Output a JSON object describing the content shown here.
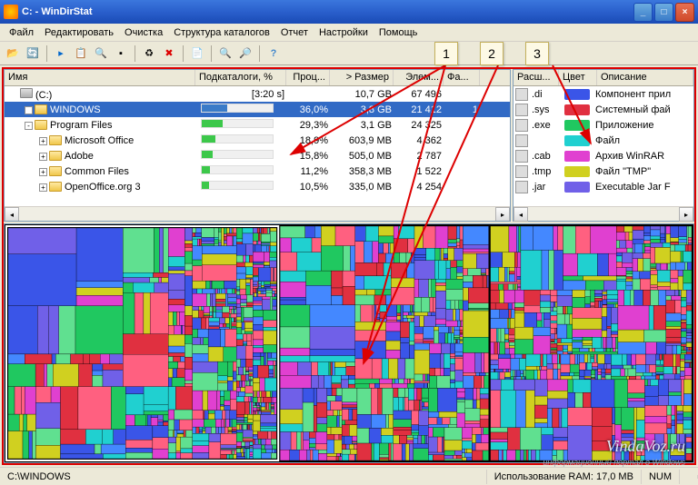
{
  "window": {
    "title": "C: - WinDirStat"
  },
  "menu": {
    "file": "Файл",
    "edit": "Редактировать",
    "cleanup": "Очистка",
    "structure": "Структура каталогов",
    "report": "Отчет",
    "settings": "Настройки",
    "help": "Помощь"
  },
  "callouts": [
    "1",
    "2",
    "3"
  ],
  "tree": {
    "headers": {
      "name": "Имя",
      "subdirs": "Подкаталоги, %",
      "percent": "Проц...",
      "size": "> Размер",
      "items": "Элем...",
      "files": "Фа..."
    },
    "rows": [
      {
        "indent": 0,
        "expander": "",
        "icon": "drive",
        "name": "(C:)",
        "pct": "",
        "size": "10,7 GB",
        "items": "67 496",
        "time_hint": "[3:20 s]",
        "bar": 100,
        "barColor": "#3a7bc8",
        "selected": false
      },
      {
        "indent": 1,
        "expander": "+",
        "icon": "folder",
        "name": "WINDOWS",
        "pct": "36,0%",
        "size": "3,8 GB",
        "items": "21 412",
        "files": "1",
        "bar": 36,
        "barColor": "#3a7bc8",
        "selected": true
      },
      {
        "indent": 1,
        "expander": "-",
        "icon": "folder",
        "name": "Program Files",
        "pct": "29,3%",
        "size": "3,1 GB",
        "items": "24 325",
        "bar": 29,
        "barColor": "#3cc84a",
        "selected": false
      },
      {
        "indent": 2,
        "expander": "+",
        "icon": "folder",
        "name": "Microsoft Office",
        "pct": "18,9%",
        "size": "603,9 MB",
        "items": "4 362",
        "bar": 19,
        "barColor": "#3cc84a",
        "selected": false
      },
      {
        "indent": 2,
        "expander": "+",
        "icon": "folder",
        "name": "Adobe",
        "pct": "15,8%",
        "size": "505,0 MB",
        "items": "2 787",
        "bar": 16,
        "barColor": "#3cc84a",
        "selected": false
      },
      {
        "indent": 2,
        "expander": "+",
        "icon": "folder",
        "name": "Common Files",
        "pct": "11,2%",
        "size": "358,3 MB",
        "items": "1 522",
        "bar": 11,
        "barColor": "#3cc84a",
        "selected": false
      },
      {
        "indent": 2,
        "expander": "+",
        "icon": "folder",
        "name": "OpenOffice.org 3",
        "pct": "10,5%",
        "size": "335,0 MB",
        "items": "4 254",
        "bar": 10,
        "barColor": "#3cc84a",
        "selected": false
      }
    ]
  },
  "legend": {
    "headers": {
      "ext": "Расш...",
      "color": "Цвет",
      "desc": "Описание"
    },
    "rows": [
      {
        "ext": ".di",
        "color": "#3a55e8",
        "desc": "Компонент прил"
      },
      {
        "ext": ".sys",
        "color": "#e03040",
        "desc": "Системный фай"
      },
      {
        "ext": ".exe",
        "color": "#20c860",
        "desc": "Приложение"
      },
      {
        "ext": "",
        "color": "#20d0d0",
        "desc": "Файл"
      },
      {
        "ext": ".cab",
        "color": "#e040d0",
        "desc": "Архив WinRAR"
      },
      {
        "ext": ".tmp",
        "color": "#d0d020",
        "desc": "Файл \"TMP\""
      },
      {
        "ext": ".jar",
        "color": "#7060e8",
        "desc": "Executable Jar F"
      }
    ]
  },
  "status": {
    "path": "C:\\WINDOWS",
    "ram_label": "Использование RAM:",
    "ram_value": "17,0 MB",
    "num": "NUM"
  },
  "watermark": "VindaVoz.ru",
  "watermark_sub": "информационный портал о Windows"
}
